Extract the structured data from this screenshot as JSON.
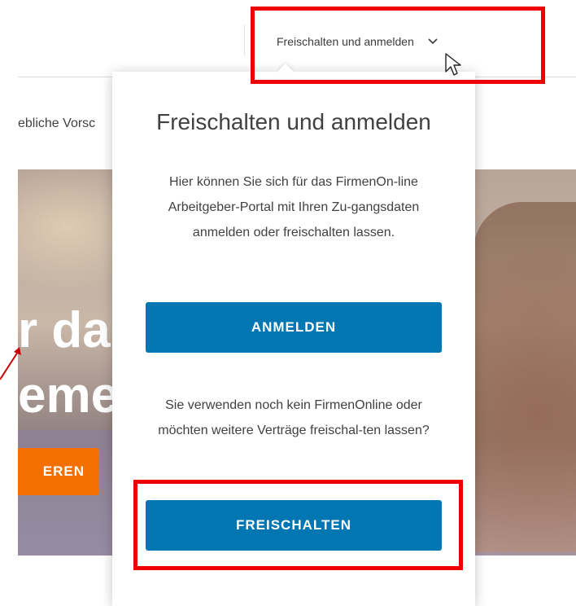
{
  "header": {
    "nav_trigger_label": "Freischalten und anmelden",
    "chevron_icon": "chevron-down-icon"
  },
  "subnav": {
    "partial_text": "ebliche Vorsc"
  },
  "hero": {
    "headline_line1": "r da",
    "headline_line2": "eme",
    "cta_label": "EREN",
    "cta_color": "#f26f00"
  },
  "dropdown": {
    "title": "Freischalten und anmelden",
    "intro_text": "Hier können Sie sich für das FirmenOn-line Arbeitgeber-Portal mit Ihren Zu-gangsdaten anmelden oder freischalten lassen.",
    "login_button": "ANMELDEN",
    "secondary_text": "Sie verwenden noch kein FirmenOnline oder möchten weitere Verträge freischal-ten lassen?",
    "unlock_button": "FREISCHALTEN",
    "button_color": "#0076b3"
  },
  "annotations": {
    "highlight_color": "#ee0000"
  }
}
